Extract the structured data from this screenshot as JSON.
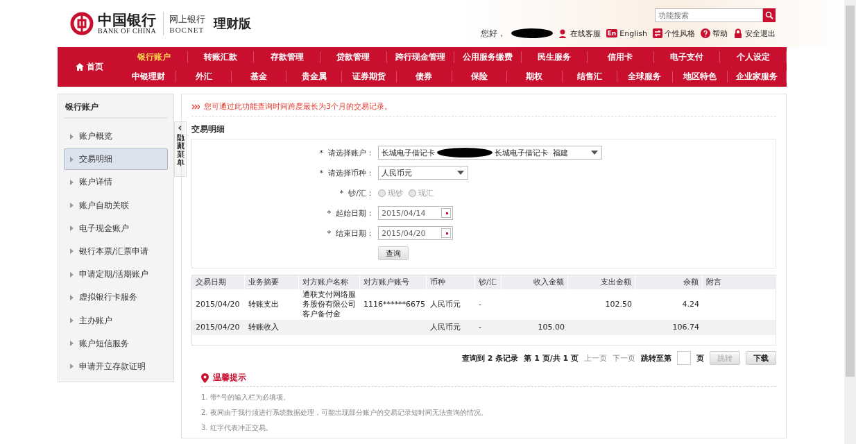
{
  "header": {
    "logo": {
      "name_cn": "中国银行",
      "name_en": "BANK OF CHINA"
    },
    "product": {
      "name_cn": "网上银行",
      "name_en": "BOCNET"
    },
    "edition": "理财版",
    "search": {
      "placeholder": "功能搜索"
    },
    "greeting": "您好，",
    "links": [
      {
        "kind": "service",
        "label": "在线客服"
      },
      {
        "kind": "english",
        "badge": "En",
        "label": "English"
      },
      {
        "kind": "style",
        "label": "个性风格"
      },
      {
        "kind": "help",
        "label": "帮助"
      },
      {
        "kind": "logout",
        "label": "安全退出"
      }
    ]
  },
  "nav": {
    "home": "首页",
    "primary": [
      {
        "label": "银行账户",
        "selected": true
      },
      {
        "label": "转账汇款",
        "selected": false
      },
      {
        "label": "存款管理",
        "selected": false
      },
      {
        "label": "贷款管理",
        "selected": false
      },
      {
        "label": "跨行现金管理",
        "selected": false
      },
      {
        "label": "公用服务缴费",
        "selected": false
      },
      {
        "label": "民生服务",
        "selected": false
      },
      {
        "label": "信用卡",
        "selected": false
      },
      {
        "label": "电子支付",
        "selected": false
      },
      {
        "label": "个人设定",
        "selected": false
      }
    ],
    "secondary": [
      {
        "label": "中银理财",
        "selected": false
      },
      {
        "label": "外汇",
        "selected": false
      },
      {
        "label": "基金",
        "selected": false
      },
      {
        "label": "贵金属",
        "selected": false
      },
      {
        "label": "证券期货",
        "selected": false
      },
      {
        "label": "债券",
        "selected": false
      },
      {
        "label": "保险",
        "selected": false
      },
      {
        "label": "期权",
        "selected": false
      },
      {
        "label": "结售汇",
        "selected": false
      },
      {
        "label": "全球服务",
        "selected": false
      },
      {
        "label": "地区特色",
        "selected": false
      },
      {
        "label": "企业家服务",
        "selected": false
      }
    ]
  },
  "sidebar": {
    "title": "银行账户",
    "items": [
      {
        "label": "账户概览",
        "selected": false
      },
      {
        "label": "交易明细",
        "selected": true
      },
      {
        "label": "账户详情",
        "selected": false
      },
      {
        "label": "账户自助关联",
        "selected": false
      },
      {
        "label": "电子现金账户",
        "selected": false
      },
      {
        "label": "银行本票/汇票申请",
        "selected": false
      },
      {
        "label": "申请定期/活期账户",
        "selected": false
      },
      {
        "label": "虚拟银行卡服务",
        "selected": false
      },
      {
        "label": "主办账户",
        "selected": false
      },
      {
        "label": "账户短信服务",
        "selected": false
      },
      {
        "label": "申请开立存款证明",
        "selected": false
      }
    ],
    "toggle": "隐藏菜单"
  },
  "notice": "您可通过此功能查询时间跨度最长为3个月的交易记录。",
  "section_title": "交易明细",
  "form": {
    "fields": [
      {
        "kind": "select",
        "mark": "*",
        "label": "请选择账户：",
        "value_before": "长城电子借记卡",
        "value_after": "长城电子借记卡  福建",
        "redacted": true,
        "wide": true
      },
      {
        "kind": "select",
        "mark": "*",
        "label": "请选择币种：",
        "value_before": "人民币元",
        "redacted": false,
        "wide": false
      },
      {
        "kind": "radio",
        "mark": "*",
        "label": "钞/汇：",
        "options": [
          {
            "label": "现钞",
            "selected": false,
            "disabled": true
          },
          {
            "label": "现汇",
            "selected": false,
            "disabled": true
          }
        ]
      },
      {
        "kind": "date",
        "mark": "*",
        "label": "起始日期：",
        "value": "2015/04/14"
      },
      {
        "kind": "date",
        "mark": "*",
        "label": "结束日期：",
        "value": "2015/04/20"
      }
    ],
    "submit": "查询"
  },
  "table": {
    "columns": [
      "交易日期",
      "业务摘要",
      "对方账户名称",
      "对方账户账号",
      "币种",
      "钞/汇",
      "收入金额",
      "支出金额",
      "余额",
      "附言"
    ],
    "rows": [
      [
        "2015/04/20",
        "转账支出",
        "通联支付网络服务股份有限公司客户备付金",
        "1116******6675",
        "人民币元",
        "-",
        "",
        "102.50",
        "4.24",
        ""
      ],
      [
        "2015/04/20",
        "转账收入",
        "",
        "",
        "人民币元",
        "-",
        "105.00",
        "",
        "106.74",
        ""
      ]
    ]
  },
  "pagination": {
    "count_before": "查询到",
    "count": "2",
    "count_after": "条记录",
    "page_before": "第",
    "page": "1",
    "page_mid": "页/共",
    "pages": "1",
    "page_after": "页",
    "prev": "上一页",
    "next": "下一页",
    "jump_label": "跳转至第",
    "jump_unit": "页",
    "jump": {
      "label": "跳转",
      "disabled": true
    },
    "download": {
      "label": "下载",
      "disabled": false
    }
  },
  "tips": {
    "title": "温馨提示",
    "items": [
      "1. 带*号的输入栏为必填项。",
      "2. 夜间由于我行须进行系统数据处理，可能出现部分账户的交易记录短时间无法查询的情况。",
      "3. 红字代表冲正交易。"
    ]
  }
}
